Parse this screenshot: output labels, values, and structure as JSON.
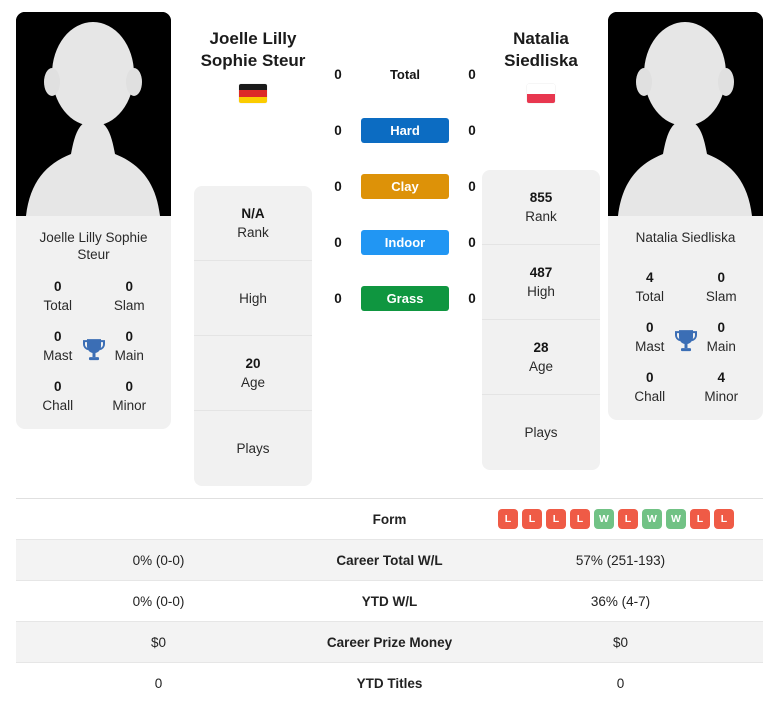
{
  "players": {
    "left": {
      "name": "Joelle Lilly Sophie Steur",
      "name_line1": "Joelle Lilly",
      "name_line2": "Sophie Steur",
      "flag_country": "Germany",
      "flag_colors": [
        "#1a1a1a",
        "#dd2a27",
        "#fbcc00"
      ],
      "avatar_alt": "player-photo-placeholder",
      "titles": [
        {
          "num": "0",
          "label": "Total"
        },
        {
          "num": "0",
          "label": "Slam"
        },
        {
          "num": "0",
          "label": "Mast"
        },
        {
          "num": "0",
          "label": "Main"
        },
        {
          "num": "0",
          "label": "Chall"
        },
        {
          "num": "0",
          "label": "Minor"
        }
      ],
      "info": [
        {
          "value": "N/A",
          "label": "Rank"
        },
        {
          "value": "",
          "label": "High"
        },
        {
          "value": "20",
          "label": "Age"
        },
        {
          "value": "",
          "label": "Plays"
        }
      ]
    },
    "right": {
      "name": "Natalia Siedliska",
      "name_line1": "Natalia",
      "name_line2": "Siedliska",
      "flag_country": "Poland",
      "flag_colors": [
        "#ffffff",
        "#e8374f"
      ],
      "avatar_alt": "player-photo-placeholder",
      "titles": [
        {
          "num": "4",
          "label": "Total"
        },
        {
          "num": "0",
          "label": "Slam"
        },
        {
          "num": "0",
          "label": "Mast"
        },
        {
          "num": "0",
          "label": "Main"
        },
        {
          "num": "0",
          "label": "Chall"
        },
        {
          "num": "4",
          "label": "Minor"
        }
      ],
      "info": [
        {
          "value": "855",
          "label": "Rank"
        },
        {
          "value": "487",
          "label": "High"
        },
        {
          "value": "28",
          "label": "Age"
        },
        {
          "value": "",
          "label": "Plays"
        }
      ]
    }
  },
  "surfaces": [
    {
      "label": "Total",
      "left": "0",
      "right": "0",
      "color": ""
    },
    {
      "label": "Hard",
      "left": "0",
      "right": "0",
      "color": "#0c6cc2"
    },
    {
      "label": "Clay",
      "left": "0",
      "right": "0",
      "color": "#dd9208"
    },
    {
      "label": "Indoor",
      "left": "0",
      "right": "0",
      "color": "#2196f3"
    },
    {
      "label": "Grass",
      "left": "0",
      "right": "0",
      "color": "#0f9640"
    }
  ],
  "table": {
    "rows": [
      {
        "label": "Form",
        "left": "",
        "right": ""
      },
      {
        "label": "Career Total W/L",
        "left": "0% (0-0)",
        "right": "57% (251-193)"
      },
      {
        "label": "YTD W/L",
        "left": "0% (0-0)",
        "right": "36% (4-7)"
      },
      {
        "label": "Career Prize Money",
        "left": "$0",
        "right": "$0"
      },
      {
        "label": "YTD Titles",
        "left": "0",
        "right": "0"
      }
    ],
    "form_right": [
      "L",
      "L",
      "L",
      "L",
      "W",
      "L",
      "W",
      "W",
      "L",
      "L"
    ],
    "form_left": [],
    "badge_colors": {
      "W": "#71c285",
      "L": "#ef5b46"
    }
  }
}
